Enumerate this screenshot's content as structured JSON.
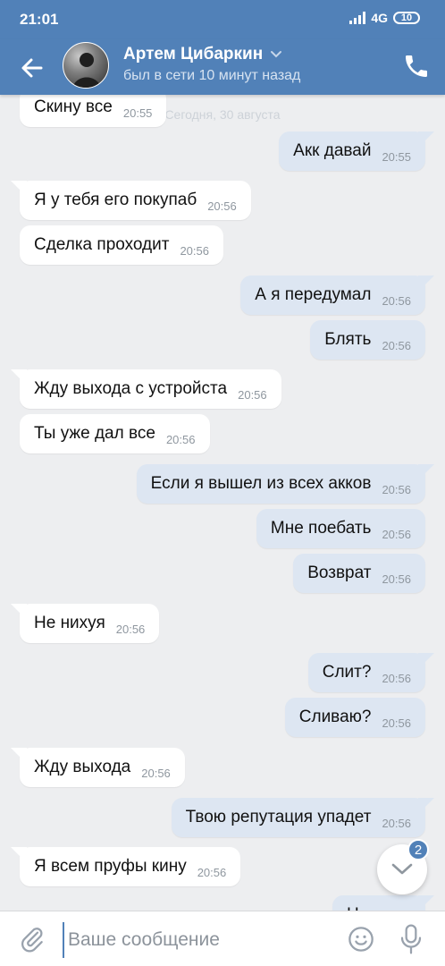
{
  "status_bar": {
    "time": "21:01",
    "network": "4G",
    "battery": "10"
  },
  "header": {
    "contact_name": "Артем Цибаркин",
    "contact_status": "был в сети 10 минут назад"
  },
  "chat": {
    "date_separator": "Сегодня, 30 августа",
    "messages": [
      {
        "dir": "in",
        "text": "Скину все",
        "time": "20:55"
      },
      {
        "dir": "out",
        "text": "Акк давай",
        "time": "20:55"
      },
      {
        "dir": "in",
        "text": "Я у тебя его покупаб",
        "time": "20:56"
      },
      {
        "dir": "in",
        "text": "Сделка проходит",
        "time": "20:56"
      },
      {
        "dir": "out",
        "text": "А я передумал",
        "time": "20:56"
      },
      {
        "dir": "out",
        "text": "Блять",
        "time": "20:56"
      },
      {
        "dir": "in",
        "text": "Жду выхода с устройста",
        "time": "20:56"
      },
      {
        "dir": "in",
        "text": "Ты уже дал все",
        "time": "20:56"
      },
      {
        "dir": "out",
        "text": "Если я вышел из всех акков",
        "time": "20:56"
      },
      {
        "dir": "out",
        "text": "Мне поебать",
        "time": "20:56"
      },
      {
        "dir": "out",
        "text": "Возврат",
        "time": "20:56"
      },
      {
        "dir": "in",
        "text": "Не нихуя",
        "time": "20:56"
      },
      {
        "dir": "out",
        "text": "Слит?",
        "time": "20:56"
      },
      {
        "dir": "out",
        "text": "Сливаю?",
        "time": "20:56"
      },
      {
        "dir": "in",
        "text": "Жду выхода",
        "time": "20:56"
      },
      {
        "dir": "out",
        "text": "Твою репутация упадет",
        "time": "20:56"
      },
      {
        "dir": "in",
        "text": "Я всем пруфы кину",
        "time": "20:56"
      },
      {
        "dir": "out",
        "text": "Н",
        "time": ""
      }
    ]
  },
  "scroll_button": {
    "unread_badge": "2"
  },
  "composer": {
    "placeholder": "Ваше сообщение"
  },
  "colors": {
    "accent": "#5181b8",
    "outgoing_bubble": "#dde6f2",
    "background": "#edeef0"
  }
}
